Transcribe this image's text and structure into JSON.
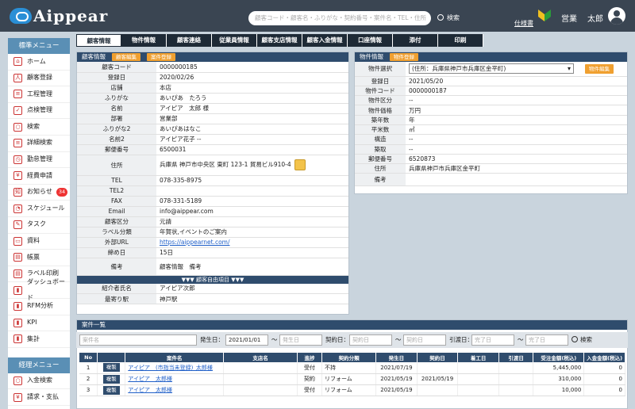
{
  "header": {
    "logo": "Aippear",
    "search_placeholder": "顧客コード・顧客名・ふりがな・契約番号・案件名・TEL・住所",
    "search_button": "検索",
    "spec_link": "仕様書",
    "user_role": "営業",
    "user_name": "太郎"
  },
  "sidebar": {
    "menu1_title": "標準メニュー",
    "items": [
      {
        "label": "ホーム",
        "icon": "home-icon",
        "glyph": "⌂"
      },
      {
        "label": "顧客登録",
        "icon": "user-icon",
        "glyph": "人"
      },
      {
        "label": "工程管理",
        "icon": "process-icon",
        "glyph": "≡"
      },
      {
        "label": "点検管理",
        "icon": "checklist-icon",
        "glyph": "✓"
      },
      {
        "label": "検索",
        "icon": "search-icon",
        "glyph": "○"
      },
      {
        "label": "詳細検索",
        "icon": "detail-search-icon",
        "glyph": "≡"
      },
      {
        "label": "勤怠管理",
        "icon": "attendance-icon",
        "glyph": "◷"
      },
      {
        "label": "経費申請",
        "icon": "expense-icon",
        "glyph": "¥"
      },
      {
        "label": "お知らせ",
        "icon": "notice-icon",
        "glyph": "知",
        "badge": "34"
      },
      {
        "label": "スケジュール",
        "icon": "schedule-icon",
        "glyph": "◔"
      },
      {
        "label": "タスク",
        "icon": "task-icon",
        "glyph": "✎"
      },
      {
        "label": "資料",
        "icon": "folder-icon",
        "glyph": "▭"
      },
      {
        "label": "帳票",
        "icon": "form-icon",
        "glyph": "▤"
      },
      {
        "label": "ラベル印刷",
        "icon": "label-print-icon",
        "glyph": "▤"
      },
      {
        "label": "ダッシュボード",
        "icon": "dashboard-icon",
        "glyph": "▮"
      },
      {
        "label": "RFM分析",
        "icon": "rfm-icon",
        "glyph": "▮"
      },
      {
        "label": "KPI",
        "icon": "kpi-icon",
        "glyph": "▮"
      },
      {
        "label": "集計",
        "icon": "aggregate-icon",
        "glyph": "▮"
      }
    ],
    "menu2_title": "経理メニュー",
    "items2": [
      {
        "label": "入金検索",
        "icon": "payment-search-icon",
        "glyph": "○"
      },
      {
        "label": "請求・支払",
        "icon": "billing-icon",
        "glyph": "¥"
      }
    ]
  },
  "tabs": [
    "顧客情報",
    "物件情報",
    "顧客連絡",
    "従業員情報",
    "顧客支店情報",
    "顧客入金情報",
    "口座情報",
    "添付",
    "印刷"
  ],
  "customer": {
    "title": "顧客情報",
    "edit_btn": "顧客編集",
    "register_btn": "案件登録",
    "rows": [
      {
        "k": "顧客コード",
        "v": "0000000185"
      },
      {
        "k": "登録日",
        "v": "2020/02/26"
      },
      {
        "k": "店舗",
        "v": "本店"
      },
      {
        "k": "ふりがな",
        "v": "あいぴあ　たろう"
      },
      {
        "k": "名前",
        "v": "アイピア　太郎 様"
      },
      {
        "k": "部署",
        "v": "営業部"
      },
      {
        "k": "ふりがな2",
        "v": "あいぴあはなこ"
      },
      {
        "k": "名前2",
        "v": "アイピア花子 --"
      },
      {
        "k": "郵便番号",
        "v": "6500031"
      },
      {
        "k": "住所",
        "v": "兵庫県 神戸市中央区 東町 123-1 貿易ビル910-4"
      },
      {
        "k": "TEL",
        "v": "078-335-8975"
      },
      {
        "k": "TEL2",
        "v": ""
      },
      {
        "k": "FAX",
        "v": "078-331-5189"
      },
      {
        "k": "Email",
        "v": "info@aippear.com"
      },
      {
        "k": "顧客区分",
        "v": "元請"
      },
      {
        "k": "ラベル分類",
        "v": "年賀状,イベントのご案内"
      },
      {
        "k": "外部URL",
        "v": "https://aippearnet.com/"
      },
      {
        "k": "締め日",
        "v": "15日"
      },
      {
        "k": "備考",
        "v": "顧客情報　備考"
      }
    ],
    "free_title": "▼▼▼ 顧客自由項目 ▼▼▼",
    "free_rows": [
      {
        "k": "紹介者氏名",
        "v": "アイピア次郎"
      },
      {
        "k": "最寄り駅",
        "v": "神戸駅"
      }
    ]
  },
  "property": {
    "title": "物件情報",
    "register_btn": "物件登録",
    "select_label": "物件選択",
    "select_value": "(住所：兵庫県神戸市兵庫区金平町)",
    "edit_btn": "物件編集",
    "rows": [
      {
        "k": "登録日",
        "v": "2021/05/20"
      },
      {
        "k": "物件コード",
        "v": "0000000187"
      },
      {
        "k": "物件区分",
        "v": "--"
      },
      {
        "k": "物件価格",
        "v": "万円"
      },
      {
        "k": "築年数",
        "v": "年"
      },
      {
        "k": "平米数",
        "v": "㎡"
      },
      {
        "k": "構造",
        "v": "--"
      },
      {
        "k": "築取",
        "v": "--"
      },
      {
        "k": "郵便番号",
        "v": "6520873"
      },
      {
        "k": "住所",
        "v": "兵庫県神戸市兵庫区金平町"
      },
      {
        "k": "備考",
        "v": ""
      }
    ]
  },
  "cases": {
    "title": "案件一覧",
    "filter": {
      "name_placeholder": "案件名",
      "start_label": "発生日：",
      "start_from": "2021/01/01",
      "start_to_placeholder": "発生日",
      "contract_label": "契約日：",
      "contract_from_placeholder": "契約日",
      "contract_to_placeholder": "契約日",
      "handover_label": "引渡日：",
      "handover_from_placeholder": "完了日",
      "handover_to_placeholder": "完了日",
      "tilde": "～",
      "search_btn": "検索"
    },
    "columns": [
      "No",
      "",
      "案件名",
      "支店名",
      "進捗",
      "契約分類",
      "発生日",
      "契約日",
      "着工日",
      "引渡日",
      "受注金額(税込)",
      "入金金額(税込)"
    ],
    "copy_label": "複製",
    "rows": [
      {
        "no": "1",
        "name": "アイピア　(市指当未登録)_太郎様",
        "branch": "",
        "status": "受付",
        "type": "不持",
        "start": "2021/07/19",
        "contract": "",
        "construct": "",
        "handover": "",
        "amount": "5,445,000",
        "paid": "0"
      },
      {
        "no": "2",
        "name": "アイピア　太郎様",
        "branch": "",
        "status": "契約",
        "type": "リフォーム",
        "start": "2021/05/19",
        "contract": "2021/05/19",
        "construct": "",
        "handover": "",
        "amount": "310,000",
        "paid": "0"
      },
      {
        "no": "3",
        "name": "アイピア　太郎様",
        "branch": "",
        "status": "受付",
        "type": "リフォーム",
        "start": "2021/05/19",
        "contract": "",
        "construct": "",
        "handover": "",
        "amount": "10,000",
        "paid": "0"
      }
    ]
  }
}
